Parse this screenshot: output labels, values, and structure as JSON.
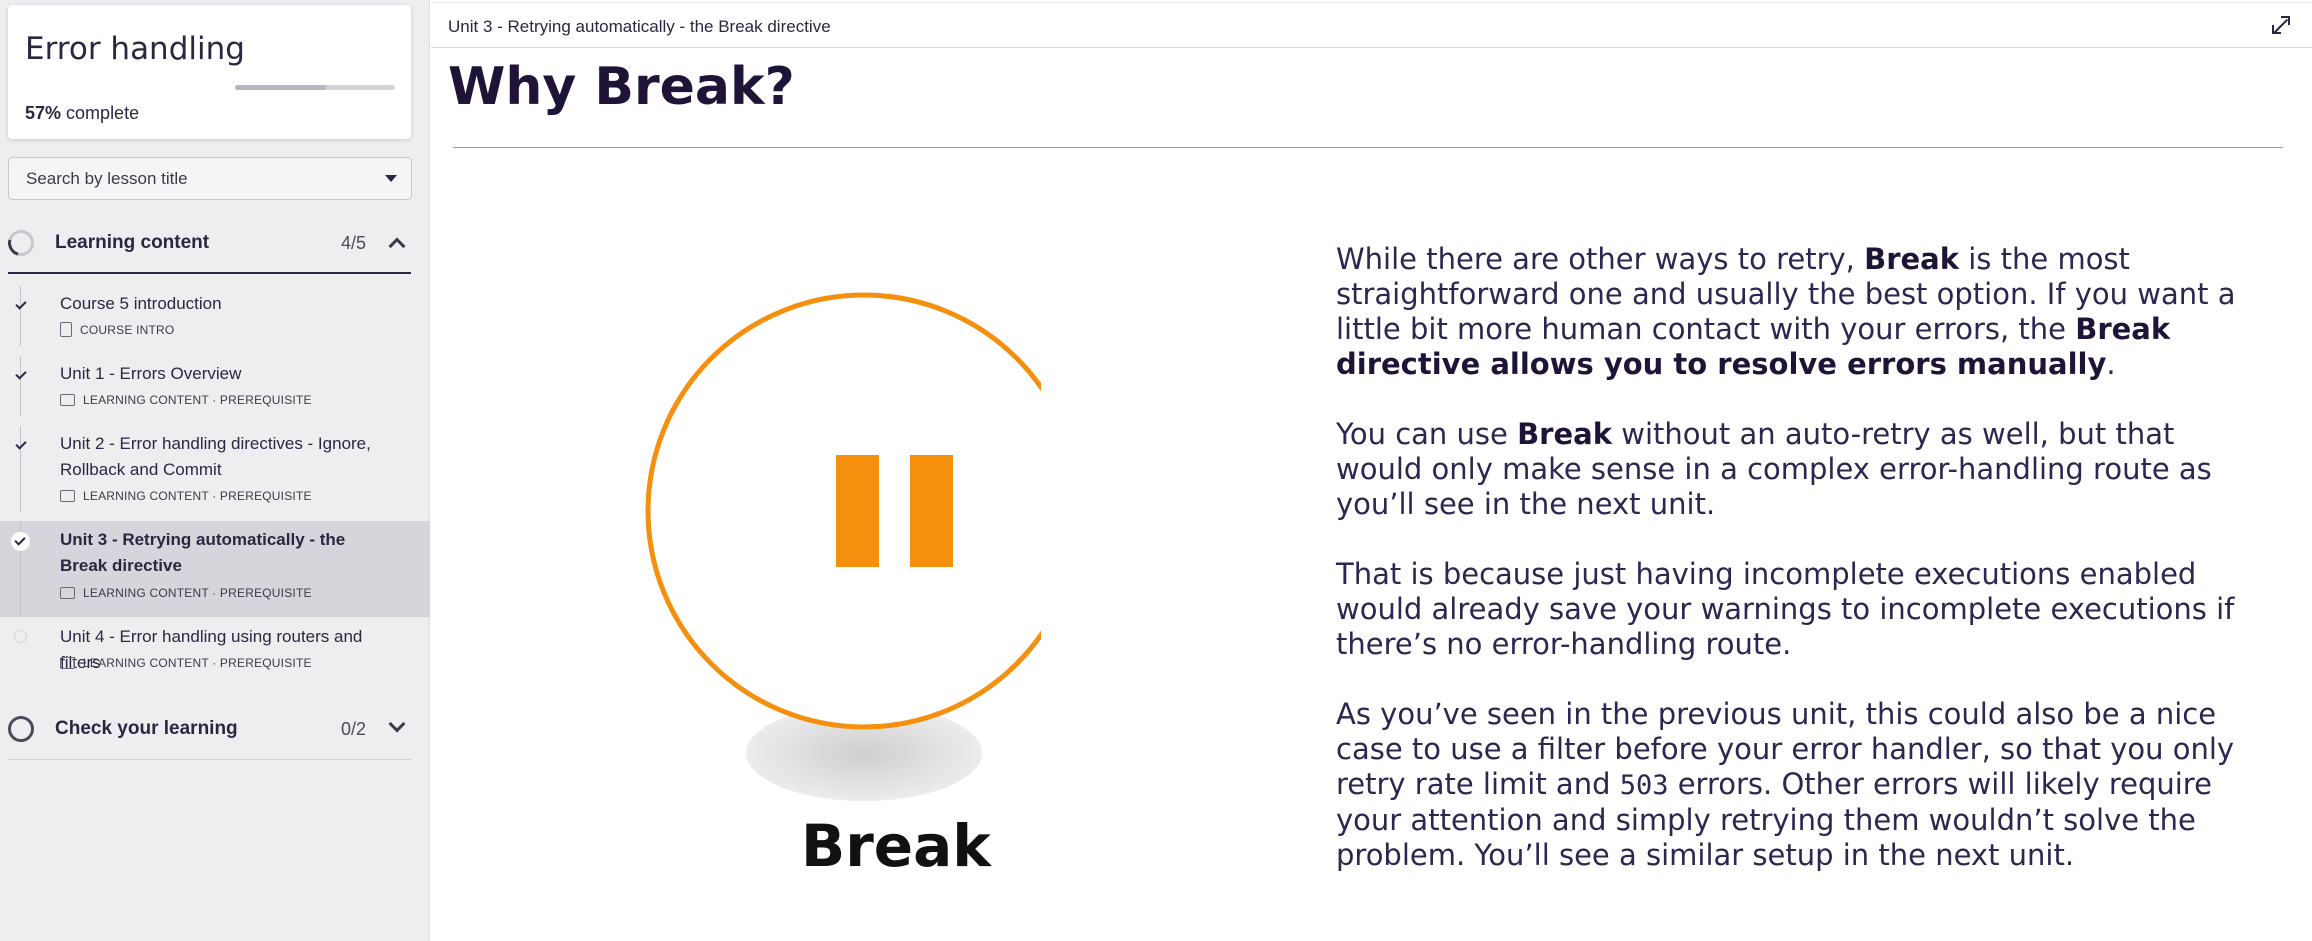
{
  "course": {
    "title": "Error handling",
    "progress_percent": 57,
    "progress_value": "57%",
    "progress_suffix": "complete"
  },
  "search": {
    "placeholder": "Search by lesson title"
  },
  "sections": [
    {
      "label": "Learning content",
      "count": "4/5",
      "expanded": true,
      "lessons": [
        {
          "title": "Course 5 introduction",
          "meta": "COURSE INTRO",
          "completed": true,
          "active": false
        },
        {
          "title": "Unit 1 - Errors Overview",
          "meta": "LEARNING CONTENT · PREREQUISITE",
          "completed": true,
          "active": false
        },
        {
          "title": "Unit 2 - Error handling directives - Ignore, Rollback and Commit",
          "meta": "LEARNING CONTENT · PREREQUISITE",
          "completed": true,
          "active": false
        },
        {
          "title": "Unit 3 - Retrying automatically - the Break directive",
          "meta": "LEARNING CONTENT · PREREQUISITE",
          "completed": true,
          "active": true
        },
        {
          "title": "Unit 4 - Error handling using routers and filters",
          "meta": "LEARNING CONTENT · PREREQUISITE",
          "completed": false,
          "active": false
        }
      ]
    },
    {
      "label": "Check your learning",
      "count": "0/2",
      "expanded": false
    }
  ],
  "header": {
    "breadcrumb": "Unit 3 - Retrying automatically - the Break directive"
  },
  "main": {
    "title": "Why Break?",
    "illustration_label": "Break",
    "paragraphs": {
      "p1_a": "While there are other ways to retry, ",
      "p1_b": "Break",
      "p1_c": " is the most straightforward one and usually the best option. If you want a little bit more human contact with your errors, the ",
      "p1_d": "Break directive allows you to resolve errors manually",
      "p1_e": ".",
      "p2_a": "You can use ",
      "p2_b": "Break",
      "p2_c": " without an auto-retry as well, but that would only make sense in a complex error-handling route as you’ll see in the next unit.",
      "p3": "That is because just having incomplete executions enabled would already save your warnings to incomplete executions if there’s no error-handling route.",
      "p4_a": "As you’ve seen in the previous unit, this could also be a nice case to use a filter before your error handler, so that you only retry rate limit and ",
      "p4_code": "503",
      "p4_b": " errors. Other errors will likely require your attention and simply retrying them wouldn’t solve the problem. You’ll see a similar setup in the next unit."
    }
  },
  "colors": {
    "accent_orange": "#f5900f",
    "title_purple": "#1f1437",
    "sidebar_bg": "#eeeef1",
    "active_item_bg": "#d6d5dc"
  }
}
